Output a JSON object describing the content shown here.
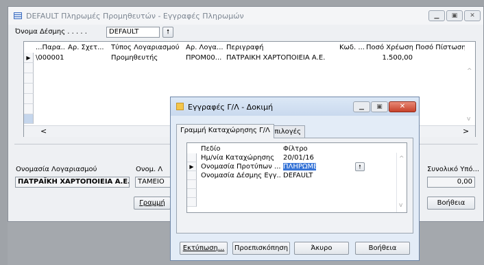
{
  "main_window": {
    "title": "DEFAULT Πληρωμές Προμηθευτών - Εγγραφές Πληρωμών",
    "batch_name_label": "Όνομα Δέσμης . . . . .",
    "batch_name_value": "DEFAULT",
    "columns": [
      "...Παρα...",
      "Αρ. Σχετ...",
      "Τύπος Λογαριασμού",
      "Αρ. Λογα...",
      "Περιγραφή",
      "Κωδ. ...",
      "Ποσό Χρέωσης",
      "Ποσό Πίστωσης"
    ],
    "rows": [
      {
        "doc": "\\000001",
        "rel": "",
        "acc_type": "Προμηθευτής",
        "acc_no": "ΠΡΟΜ00...",
        "description": "ΠΑΤΡΑΪΚΗ ΧΑΡΤΟΠΟΙΕΙΑ Α.Ε.",
        "code": "",
        "debit": "1.500,00",
        "credit": ""
      }
    ],
    "footer": {
      "account_name_label": "Ονομασία Λογαριασμού",
      "account_name_value": "ΠΑΤΡΑΪΚΗ ΧΑΡΤΟΠΟΙΕΙΑ Α.Ε.",
      "bal_acc_label": "Ονομ. Λ",
      "bal_acc_value": "ΤΑΜΕΙΟ",
      "total_label": "Συνολικό Υπό...",
      "total_value": "0,00"
    },
    "buttons": {
      "line": "Γραμμή",
      "help": "Βοήθεια"
    },
    "scroll_left": "<",
    "scroll_right": ">"
  },
  "dialog": {
    "title": "Εγγραφές Γ/Λ - Δοκιμή",
    "tabs": [
      "Γραμμή Καταχώρησης Γ/Λ",
      "Επιλογές"
    ],
    "filter_columns": [
      "Πεδίο",
      "Φίλτρο"
    ],
    "filters": [
      {
        "field": "Ημ/νία Καταχώρησης",
        "value": "20/01/16"
      },
      {
        "field": "Ονομασία Προτύπων ...",
        "value": "ΠΛΗΡΩΜΕΣ"
      },
      {
        "field": "Ονομασία Δέσμης Εγγ...",
        "value": "DEFAULT"
      }
    ],
    "buttons": {
      "print": "Εκτύπωση...",
      "preview": "Προεπισκόπηση",
      "cancel": "Άκυρο",
      "help": "Βοήθεια"
    }
  }
}
